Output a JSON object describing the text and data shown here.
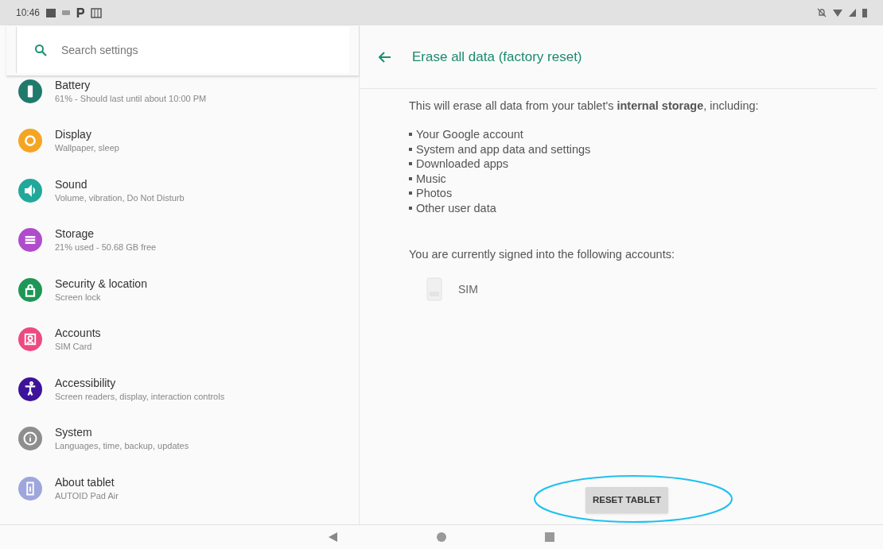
{
  "status_bar": {
    "time": "10:46"
  },
  "search": {
    "placeholder": "Search settings"
  },
  "settings": [
    {
      "title": "Battery",
      "subtitle": "61% - Should last until about 10:00 PM",
      "kind": "battery",
      "color": "#1f7a6c"
    },
    {
      "title": "Display",
      "subtitle": "Wallpaper, sleep",
      "kind": "display",
      "color": "#f5a524"
    },
    {
      "title": "Sound",
      "subtitle": "Volume, vibration, Do Not Disturb",
      "kind": "sound",
      "color": "#21a89a"
    },
    {
      "title": "Storage",
      "subtitle": "21% used - 50.68 GB free",
      "kind": "storage",
      "color": "#b04ccc"
    },
    {
      "title": "Security & location",
      "subtitle": "Screen lock",
      "kind": "security",
      "color": "#1e9656"
    },
    {
      "title": "Accounts",
      "subtitle": "SIM Card",
      "kind": "accounts",
      "color": "#ec4a80"
    },
    {
      "title": "Accessibility",
      "subtitle": "Screen readers, display, interaction controls",
      "kind": "accessibility",
      "color": "#3d1499"
    },
    {
      "title": "System",
      "subtitle": "Languages, time, backup, updates",
      "kind": "system",
      "color": "#8e8e8e"
    },
    {
      "title": "About tablet",
      "subtitle": "AUTOID Pad Air",
      "kind": "about",
      "color": "#9ea6dc"
    }
  ],
  "detail": {
    "title": "Erase all data (factory reset)",
    "intro": "This will erase all data from your tablet's **internal storage**, including:",
    "items": [
      "Your Google account",
      "System and app data and settings",
      "Downloaded apps",
      "Music",
      "Photos",
      "Other user data"
    ],
    "accounts_heading": "You are currently signed into the following accounts:",
    "accounts": [
      "SIM"
    ],
    "button": "RESET TABLET"
  }
}
